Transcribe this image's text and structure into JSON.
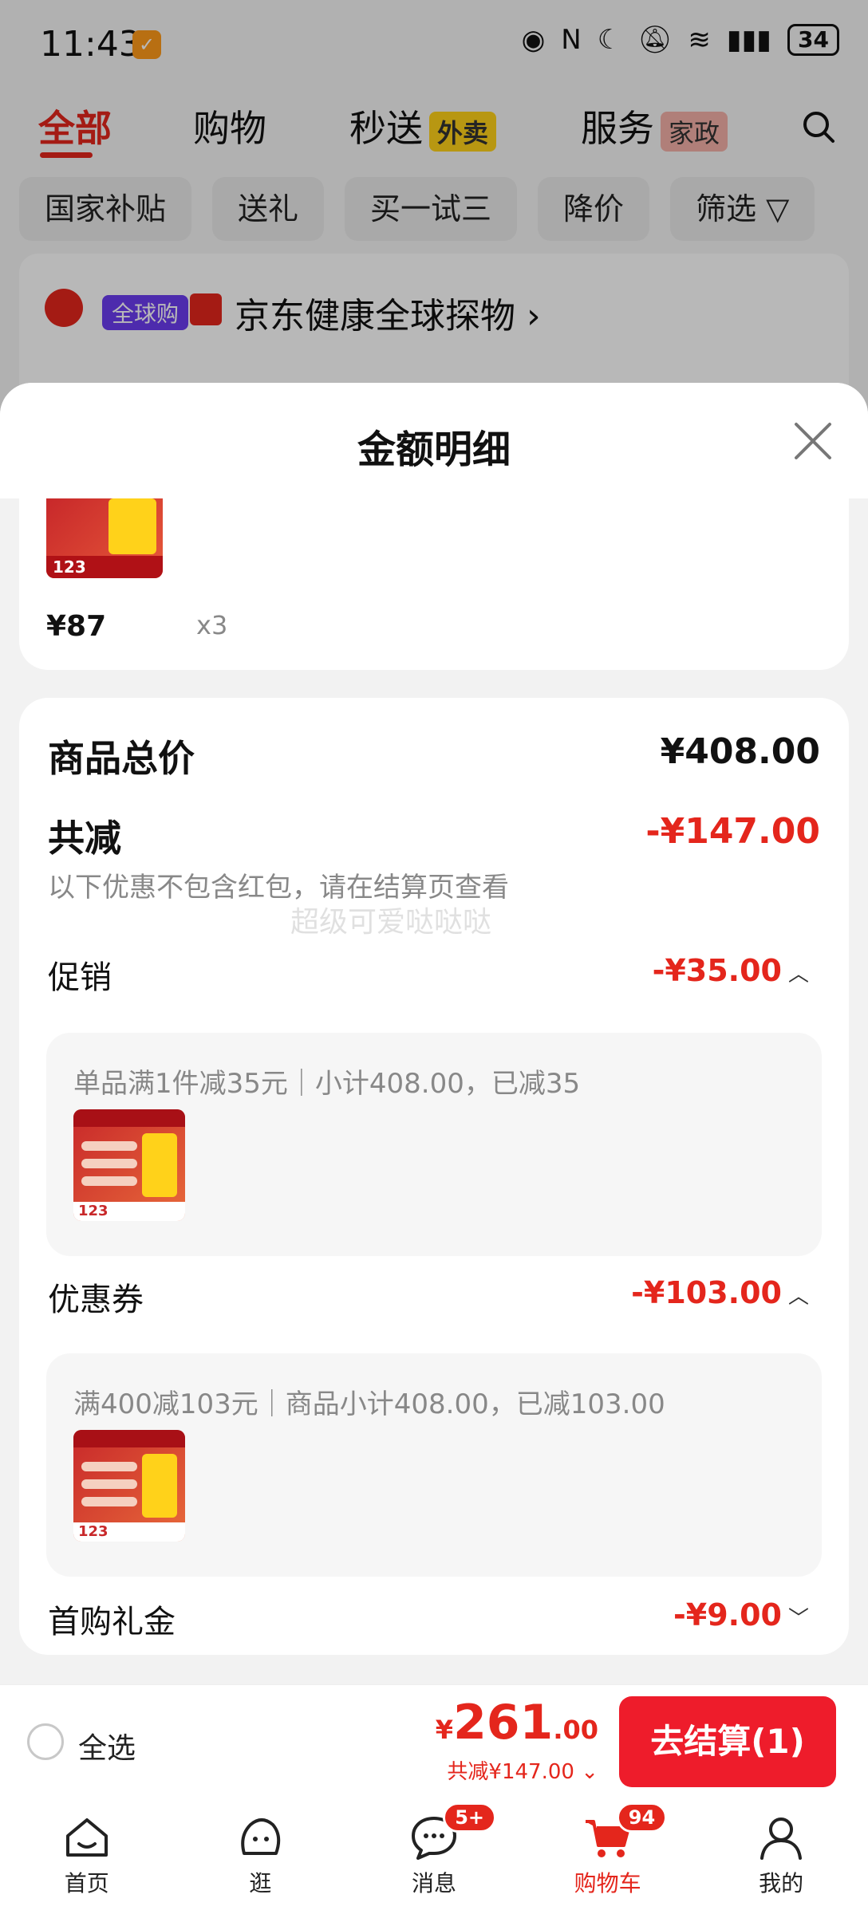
{
  "status_bar": {
    "time": "11:43",
    "battery": "34"
  },
  "top_tabs": [
    {
      "label": "全部",
      "tag": ""
    },
    {
      "label": "购物",
      "tag": ""
    },
    {
      "label": "秒送",
      "tag": "外卖"
    },
    {
      "label": "服务",
      "tag": "家政"
    }
  ],
  "filters": [
    "国家补贴",
    "送礼",
    "买一试三",
    "降价",
    "筛选 ▽"
  ],
  "store": {
    "tag": "全球购",
    "name": "京东健康全球探物 ›"
  },
  "sheet": {
    "title": "金额明细",
    "item": {
      "price": "¥87",
      "qty": "x3",
      "thumb_price": "123"
    },
    "total": {
      "label": "商品总价",
      "value": "¥408.00"
    },
    "discount": {
      "label": "共减",
      "value": "-¥147.00",
      "note": "以下优惠不包含红包，请在结算页查看"
    },
    "watermark": "超级可爱哒哒哒",
    "promotion": {
      "label": "促销",
      "value": "-¥35.00",
      "detail": "单品满1件减35元｜小计408.00，已减35",
      "thumb_price": "123"
    },
    "coupon": {
      "label": "优惠券",
      "value": "-¥103.00",
      "detail": "满400减103元｜商品小计408.00，已减103.00",
      "thumb_price": "123"
    },
    "first_gift": {
      "label": "首购礼金",
      "value": "-¥9.00"
    }
  },
  "checkout": {
    "select_all": "全选",
    "price_symbol": "¥",
    "price_int": "261",
    "price_dec": ".00",
    "saved": "共减¥147.00 ⌄",
    "button": "去结算(1)"
  },
  "bottom_nav": [
    {
      "label": "首页",
      "icon": "home-icon",
      "badge": ""
    },
    {
      "label": "逛",
      "icon": "browse-icon",
      "badge": ""
    },
    {
      "label": "消息",
      "icon": "message-icon",
      "badge": "5+"
    },
    {
      "label": "购物车",
      "icon": "cart-icon",
      "badge": "94"
    },
    {
      "label": "我的",
      "icon": "profile-icon",
      "badge": ""
    }
  ],
  "colors": {
    "accent": "#e4261c",
    "button": "#ee1c2b"
  }
}
